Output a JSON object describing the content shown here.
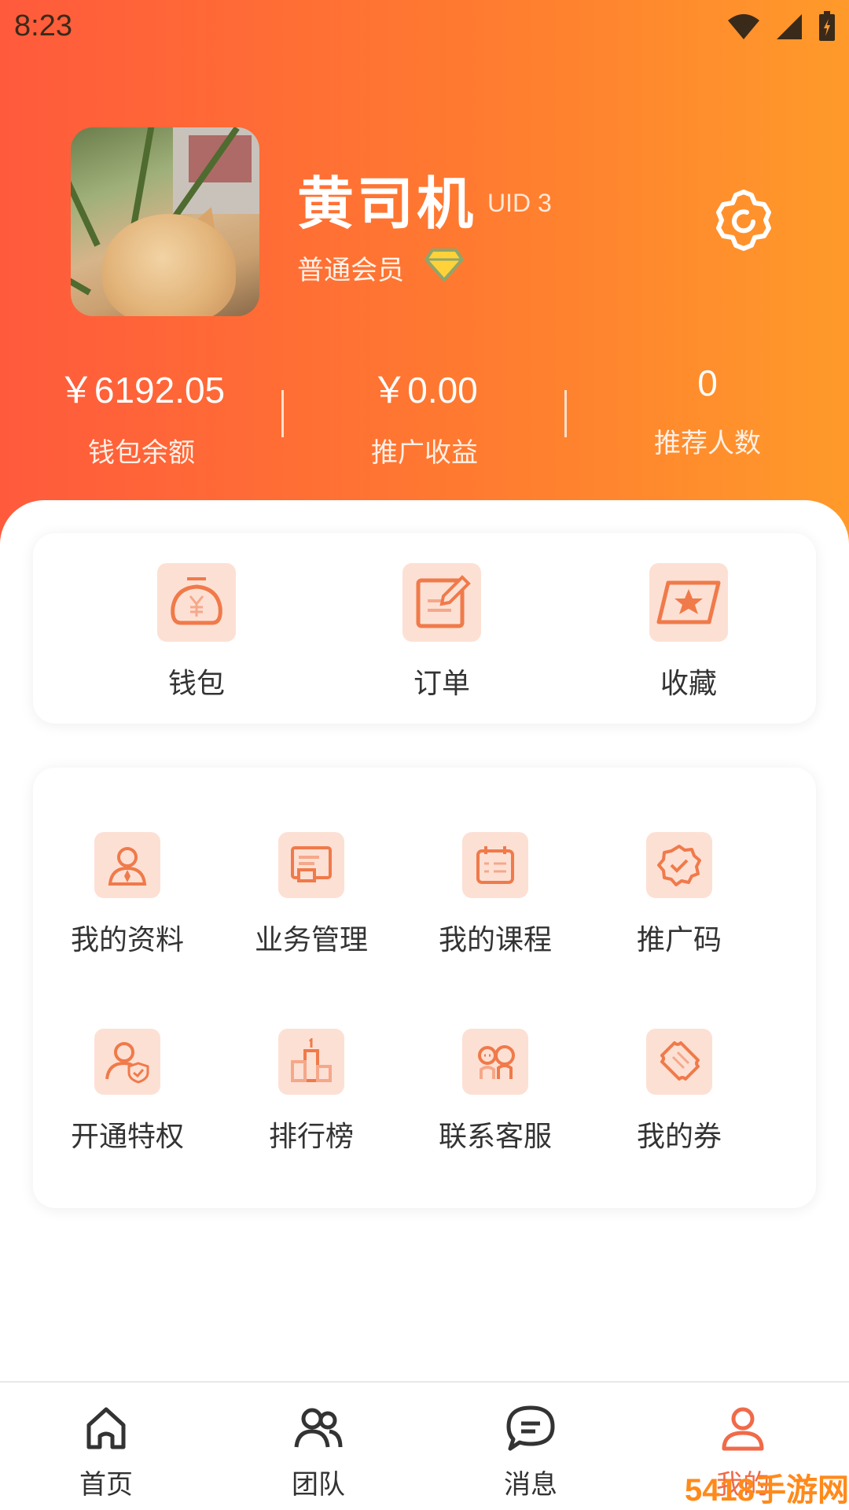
{
  "status_bar": {
    "time": "8:23"
  },
  "profile": {
    "name": "黄司机",
    "uid": "UID 3",
    "member_level": "普通会员"
  },
  "stats": [
    {
      "value": "￥6192.05",
      "label": "钱包余额"
    },
    {
      "value": "￥0.00",
      "label": "推广收益"
    },
    {
      "value": "0",
      "label": "推荐人数"
    }
  ],
  "quick_actions": [
    {
      "label": "钱包",
      "icon": "wallet-icon"
    },
    {
      "label": "订单",
      "icon": "order-icon"
    },
    {
      "label": "收藏",
      "icon": "favorites-icon"
    }
  ],
  "services": [
    {
      "label": "我的资料",
      "icon": "profile-icon"
    },
    {
      "label": "业务管理",
      "icon": "business-icon"
    },
    {
      "label": "我的课程",
      "icon": "calendar-icon"
    },
    {
      "label": "推广码",
      "icon": "badge-check-icon"
    },
    {
      "label": "开通特权",
      "icon": "user-shield-icon"
    },
    {
      "label": "排行榜",
      "icon": "podium-icon"
    },
    {
      "label": "联系客服",
      "icon": "support-icon"
    },
    {
      "label": "我的券",
      "icon": "ticket-icon"
    }
  ],
  "tabs": [
    {
      "label": "首页",
      "icon": "home-icon"
    },
    {
      "label": "团队",
      "icon": "team-icon"
    },
    {
      "label": "消息",
      "icon": "message-icon"
    },
    {
      "label": "我的",
      "icon": "user-icon"
    }
  ],
  "watermark": "5418手游网",
  "colors": {
    "accent": "#f06a4a",
    "header_start": "#ff5a3c",
    "header_end": "#ff9a2a",
    "icon_bg": "#fde0d4"
  }
}
